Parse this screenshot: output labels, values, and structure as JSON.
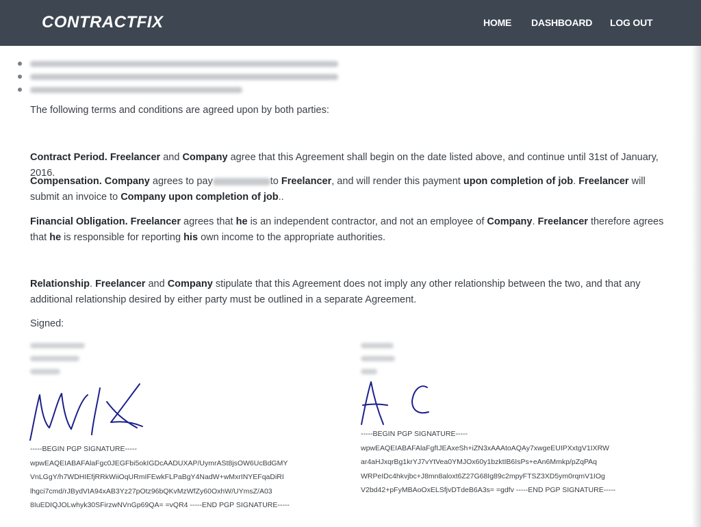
{
  "nav": {
    "brand": "CONTRACTFIX",
    "home": "HOME",
    "dashboard": "DASHBOARD",
    "logout": "LOG OUT"
  },
  "intro": "The following terms and conditions are agreed upon by both parties:",
  "contract_period": {
    "heading": "Contract Period.",
    "party_a": "Freelancer",
    "and": "and",
    "party_b": "Company",
    "text": "agree that this Agreement shall begin on the date listed above, and continue until 31st of January, 2016."
  },
  "compensation": {
    "heading": "Compensation.",
    "party_b": "Company",
    "t1": "agrees to pay",
    "t2": "to",
    "party_a": "Freelancer",
    "t3": ", and will render this payment",
    "b1": "upon completion of job",
    "t4": ".",
    "party_a2": "Freelancer",
    "t5": "will submit an invoice to",
    "b2": "Company upon completion of job",
    "t6": ".."
  },
  "financial": {
    "heading": "Financial Obligation.",
    "party_a": "Freelancer",
    "t1": "agrees that",
    "he": "he",
    "t2": "is an independent contractor, and not an employee of",
    "party_b": "Company",
    "t3": ".",
    "party_a2": "Freelancer",
    "t4": "therefore agrees that",
    "he2": "he",
    "t5": "is responsible for reporting",
    "his": "his",
    "t6": "own income to the appropriate authorities."
  },
  "relationship": {
    "heading": "Relationship",
    "dot": ".",
    "party_a": "Freelancer",
    "and": "and",
    "party_b": "Company",
    "text": "stipulate that this Agreement does not imply any other relationship between the two, and that any additional relationship desired by either party must be outlined in a separate Agreement."
  },
  "signed_label": "Signed:",
  "pgp_left": [
    "-----BEGIN PGP SIGNATURE-----",
    "wpwEAQEIABAFAlaFgc0JEGFbi5okIGDcAADUXAP/UymrASt8jsOW6UcBdGMY",
    "VnLGgY/h7WDHIEfjRRkWiiOqURmIFEwkFLPaBgY4NadW+wMxrINYEFqaDiRI",
    "lhgci7cmd/rJBydVIA94xAB3Yz27pOtz96bQKvMzWfZy60OxhW/UYmsZ/A03",
    "8IuEDIQJOLwhyk30SFirzwNVnGp69QA= =vQR4 -----END PGP SIGNATURE-----"
  ],
  "pgp_right": [
    "-----BEGIN PGP SIGNATURE-----",
    "wpwEAQEIABAFAlaFgfIJEAxeSh+iZN3xAAAtoAQAy7xwgeEUIPXxtgV1IXRW",
    "ar4aHJxqrBg1krYJ7vYtVea0YMJOx60y1bzktIB6IsPs+eAn6Mmkp/pZqPAq",
    "WRPeIDc4hkvjbc+J8mn8aloxt6Z27G68Ig89c2mpyFTSZ3XD5ym0rqmV1IOg",
    "V2bd42+pFyMBAoOxELSfjvDTdeB6A3s= =gdfv -----END PGP SIGNATURE-----"
  ]
}
